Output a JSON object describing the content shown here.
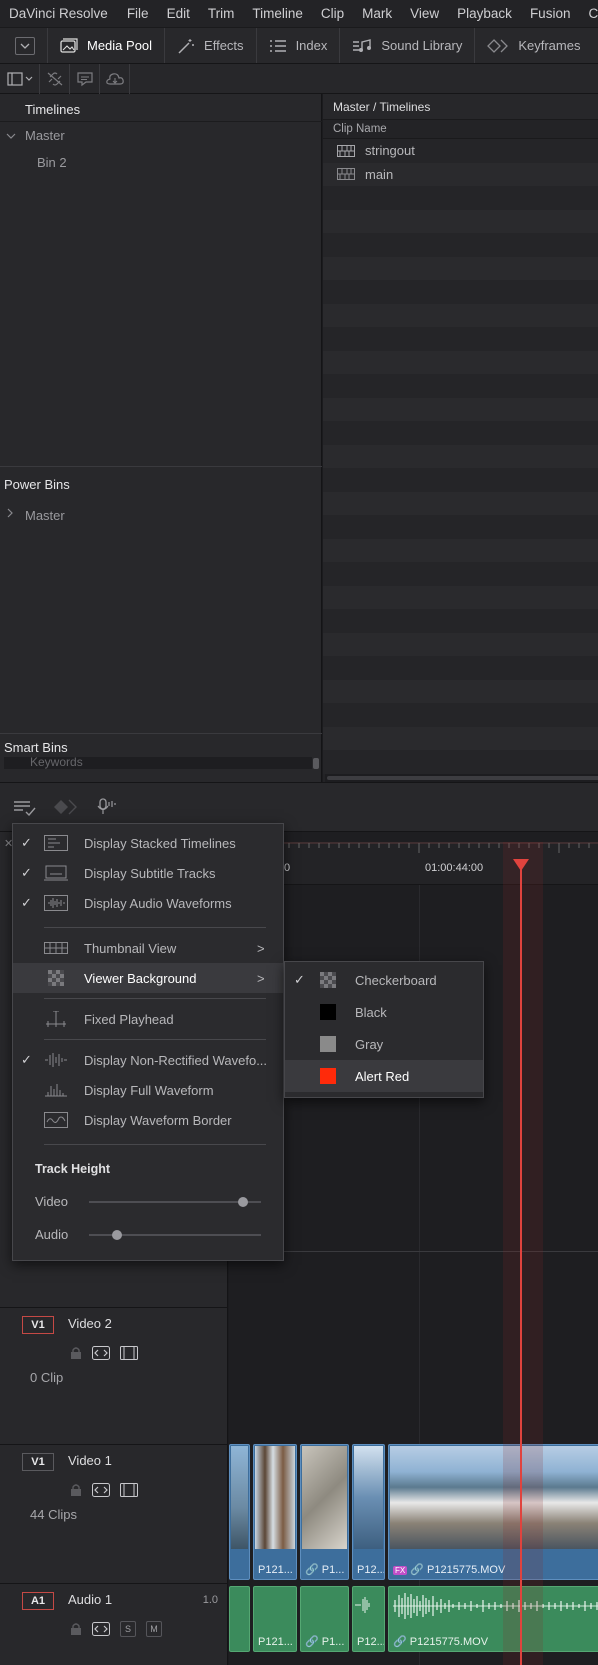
{
  "menubar": {
    "app_name": "DaVinci Resolve",
    "items": [
      "File",
      "Edit",
      "Trim",
      "Timeline",
      "Clip",
      "Mark",
      "View",
      "Playback",
      "Fusion",
      "Colo"
    ]
  },
  "toolbar": {
    "media_pool": "Media Pool",
    "effects": "Effects",
    "index": "Index",
    "sound_library": "Sound Library",
    "keyframes": "Keyframes"
  },
  "bins": {
    "title": "Timelines",
    "master": "Master",
    "bin2": "Bin 2",
    "power_bins": "Power Bins",
    "power_master": "Master",
    "smart_bins": "Smart Bins",
    "keywords": "Keywords"
  },
  "pool": {
    "path": "Master / Timelines",
    "column": "Clip Name",
    "clips": [
      "stringout",
      "main"
    ]
  },
  "ruler": {
    "tc1": "0",
    "tc2": "01:00:44:00"
  },
  "menu": {
    "items": [
      {
        "label": "Display Stacked Timelines",
        "checked": true
      },
      {
        "label": "Display Subtitle Tracks",
        "checked": true
      },
      {
        "label": "Display Audio Waveforms",
        "checked": true
      },
      {
        "label": "Thumbnail View",
        "checked": false
      },
      {
        "label": "Viewer Background",
        "checked": false
      },
      {
        "label": "Fixed Playhead",
        "checked": false
      },
      {
        "label": "Display Non-Rectified Wavefo...",
        "checked": true
      },
      {
        "label": "Display Full Waveform",
        "checked": false
      },
      {
        "label": "Display Waveform Border",
        "checked": false
      }
    ],
    "track_height": "Track Height",
    "video": "Video",
    "audio": "Audio",
    "video_level": 0.92,
    "audio_level": 0.14
  },
  "submenu": {
    "items": [
      {
        "label": "Checkerboard",
        "checked": true,
        "color": "checker"
      },
      {
        "label": "Black",
        "checked": false,
        "color": "#000000"
      },
      {
        "label": "Gray",
        "checked": false,
        "color": "#8a8a8a"
      },
      {
        "label": "Alert Red",
        "checked": false,
        "color": "#ff2a0a"
      }
    ]
  },
  "tracks": {
    "v2": {
      "tag": "V1",
      "name": "Video 2",
      "count": "0 Clip"
    },
    "v1": {
      "tag": "V1",
      "name": "Video 1",
      "count": "44 Clips"
    },
    "a1": {
      "tag": "A1",
      "name": "Audio 1",
      "level": "1.0",
      "solo": "S",
      "mute": "M"
    }
  },
  "clips": {
    "video": [
      "P121...",
      "P1...",
      "P12...",
      "P1215775.MOV"
    ],
    "audio": [
      "P121...",
      "P1...",
      "P12...",
      "P1215775.MOV"
    ],
    "fx": "FX"
  }
}
